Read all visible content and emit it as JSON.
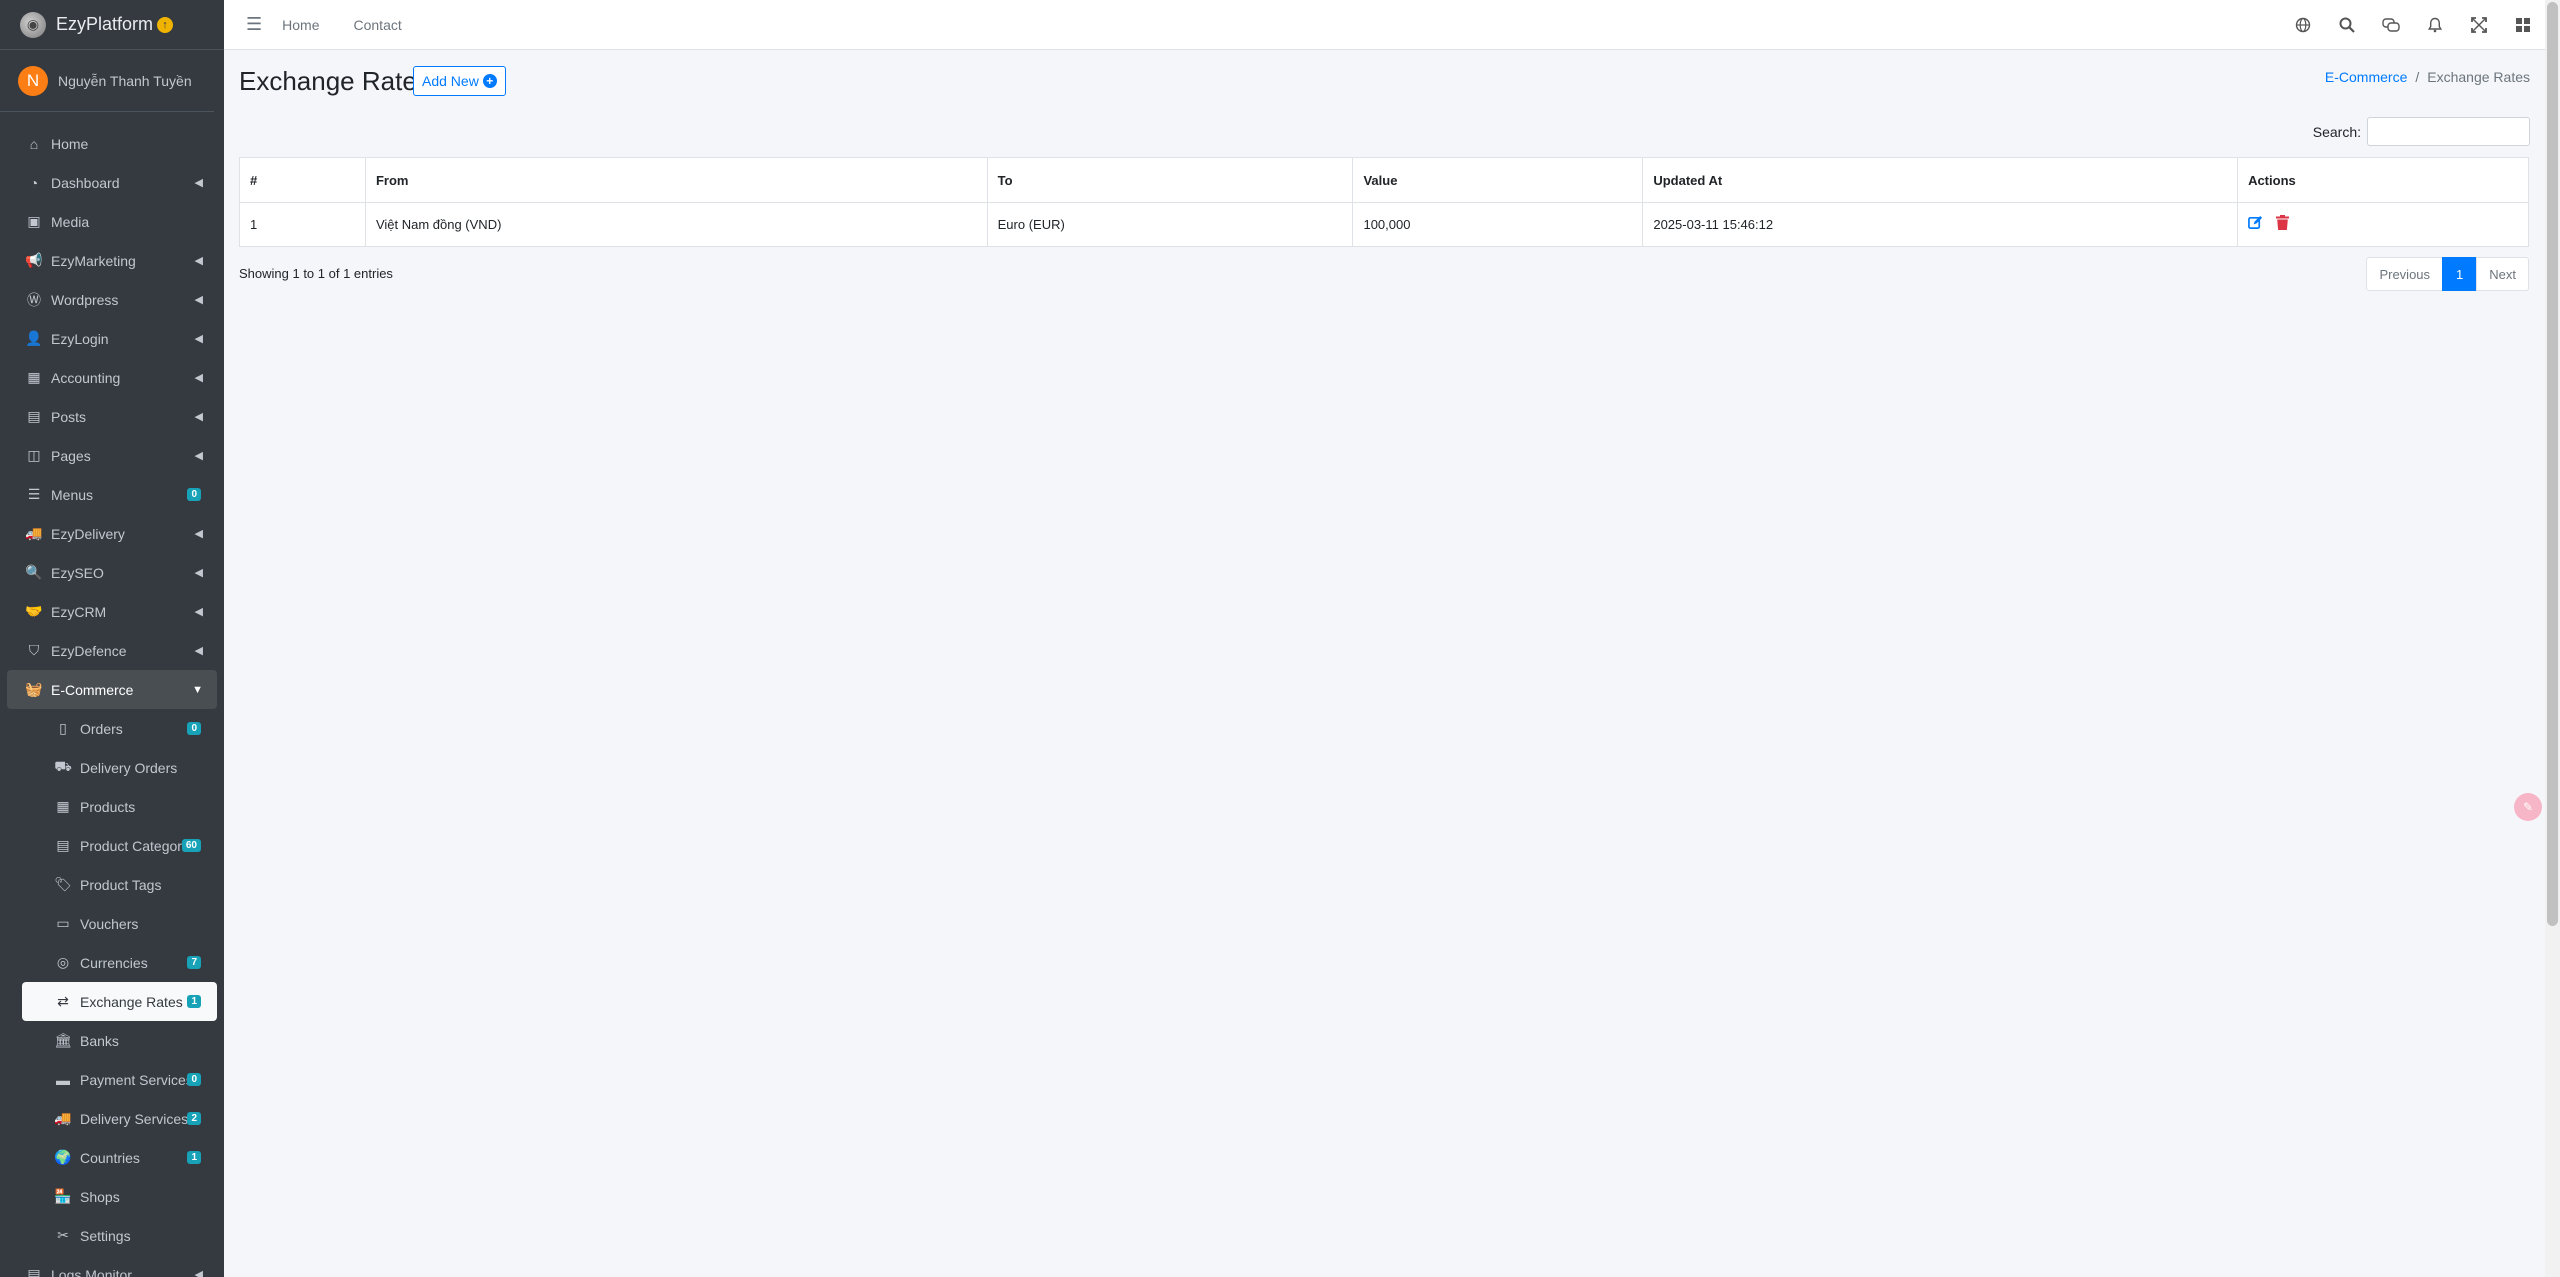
{
  "brand": {
    "name": "EzyPlatform",
    "badge": "↑"
  },
  "user": {
    "initial": "N",
    "name": "Nguyễn Thanh Tuyền"
  },
  "sidebar": {
    "items": [
      {
        "label": "Home",
        "icon": "home-icon"
      },
      {
        "label": "Dashboard",
        "icon": "dashboard-icon"
      },
      {
        "label": "Media",
        "icon": "image-icon"
      },
      {
        "label": "EzyMarketing",
        "icon": "megaphone-icon"
      },
      {
        "label": "Wordpress",
        "icon": "wordpress-icon"
      },
      {
        "label": "EzyLogin",
        "icon": "user-lock-icon"
      },
      {
        "label": "Accounting",
        "icon": "calculator-icon"
      },
      {
        "label": "Posts",
        "icon": "posts-icon"
      },
      {
        "label": "Pages",
        "icon": "pages-icon"
      },
      {
        "label": "Menus",
        "icon": "menu-icon",
        "badge": "0"
      },
      {
        "label": "EzyDelivery",
        "icon": "truck-icon"
      },
      {
        "label": "EzySEO",
        "icon": "search-icon"
      },
      {
        "label": "EzyCRM",
        "icon": "handshake-icon"
      },
      {
        "label": "EzyDefence",
        "icon": "shield-icon"
      },
      {
        "label": "E-Commerce",
        "icon": "basket-icon"
      }
    ],
    "ecommerce_sub": [
      {
        "label": "Orders",
        "icon": "orders-icon",
        "badge": "0"
      },
      {
        "label": "Delivery Orders",
        "icon": "boxes-icon"
      },
      {
        "label": "Products",
        "icon": "cubes-icon"
      },
      {
        "label": "Product Categories",
        "icon": "clipboard-icon",
        "badge": "60"
      },
      {
        "label": "Product Tags",
        "icon": "tags-icon"
      },
      {
        "label": "Vouchers",
        "icon": "ticket-icon"
      },
      {
        "label": "Currencies",
        "icon": "coins-icon",
        "badge": "7"
      },
      {
        "label": "Exchange Rates",
        "icon": "exchange-icon",
        "badge": "1"
      },
      {
        "label": "Banks",
        "icon": "bank-icon"
      },
      {
        "label": "Payment Services",
        "icon": "credit-card-icon",
        "badge": "0"
      },
      {
        "label": "Delivery Services",
        "icon": "truck-icon",
        "badge": "2"
      },
      {
        "label": "Countries",
        "icon": "globe-icon",
        "badge": "1"
      },
      {
        "label": "Shops",
        "icon": "store-icon"
      },
      {
        "label": "Settings",
        "icon": "tools-icon"
      }
    ],
    "logs_label": "Logs Monitor"
  },
  "topbar": {
    "home": "Home",
    "contact": "Contact"
  },
  "page": {
    "title": "Exchange Rates",
    "add_new": "Add New",
    "breadcrumb_parent": "E-Commerce",
    "breadcrumb_current": "Exchange Rates",
    "search_label": "Search:",
    "search_value": ""
  },
  "table": {
    "headers": [
      "#",
      "From",
      "To",
      "Value",
      "Updated At",
      "Actions"
    ],
    "rows": [
      {
        "index": "1",
        "from": "Việt Nam đồng (VND)",
        "to": "Euro (EUR)",
        "value": "100,000",
        "updated_at": "2025-03-11 15:46:12"
      }
    ]
  },
  "footer": {
    "info": "Showing 1 to 1 of 1 entries",
    "prev": "Previous",
    "page": "1",
    "next": "Next"
  }
}
